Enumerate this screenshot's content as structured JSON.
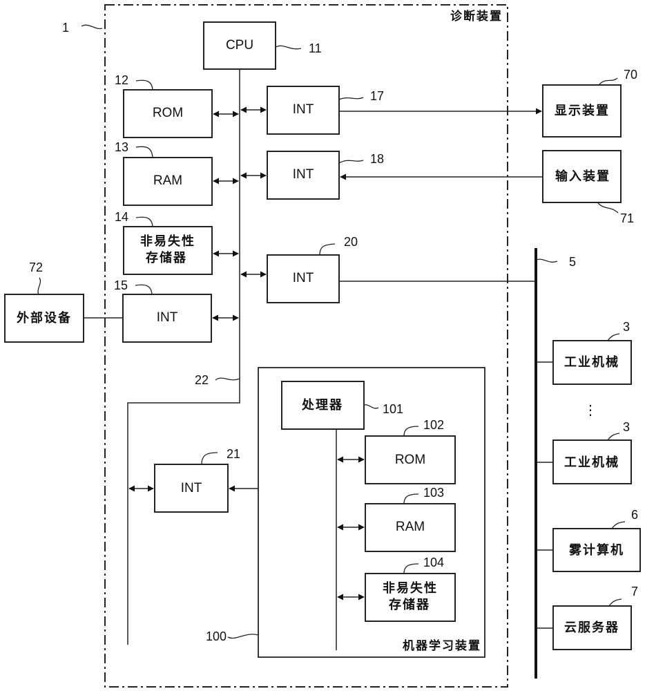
{
  "diagram": {
    "outer_device": {
      "ref": "1",
      "title": "诊断装置"
    },
    "cpu": {
      "label": "CPU",
      "ref": "11"
    },
    "rom": {
      "label": "ROM",
      "ref": "12"
    },
    "ram": {
      "label": "RAM",
      "ref": "13"
    },
    "nvm": {
      "label_line1": "非易失性",
      "label_line2": "存储器",
      "ref": "14"
    },
    "int15": {
      "label": "INT",
      "ref": "15"
    },
    "int17": {
      "label": "INT",
      "ref": "17"
    },
    "int18": {
      "label": "INT",
      "ref": "18"
    },
    "int20": {
      "label": "INT",
      "ref": "20"
    },
    "int21": {
      "label": "INT",
      "ref": "21"
    },
    "bus22": {
      "ref": "22"
    },
    "display": {
      "label": "显示装置",
      "ref": "70"
    },
    "input": {
      "label": "输入装置",
      "ref": "71"
    },
    "external": {
      "label": "外部设备",
      "ref": "72"
    },
    "network": {
      "ref": "5"
    },
    "ml_device": {
      "ref": "100",
      "title": "机器学习装置",
      "processor": {
        "label": "处理器",
        "ref": "101"
      },
      "rom": {
        "label": "ROM",
        "ref": "102"
      },
      "ram": {
        "label": "RAM",
        "ref": "103"
      },
      "nvm": {
        "label_line1": "非易失性",
        "label_line2": "存储器",
        "ref": "104"
      }
    },
    "machine1": {
      "label": "工业机械",
      "ref": "3"
    },
    "ellipsis": "⋮",
    "machine2": {
      "label": "工业机械",
      "ref": "3"
    },
    "fog": {
      "label": "雾计算机",
      "ref": "6"
    },
    "cloud": {
      "label": "云服务器",
      "ref": "7"
    }
  }
}
